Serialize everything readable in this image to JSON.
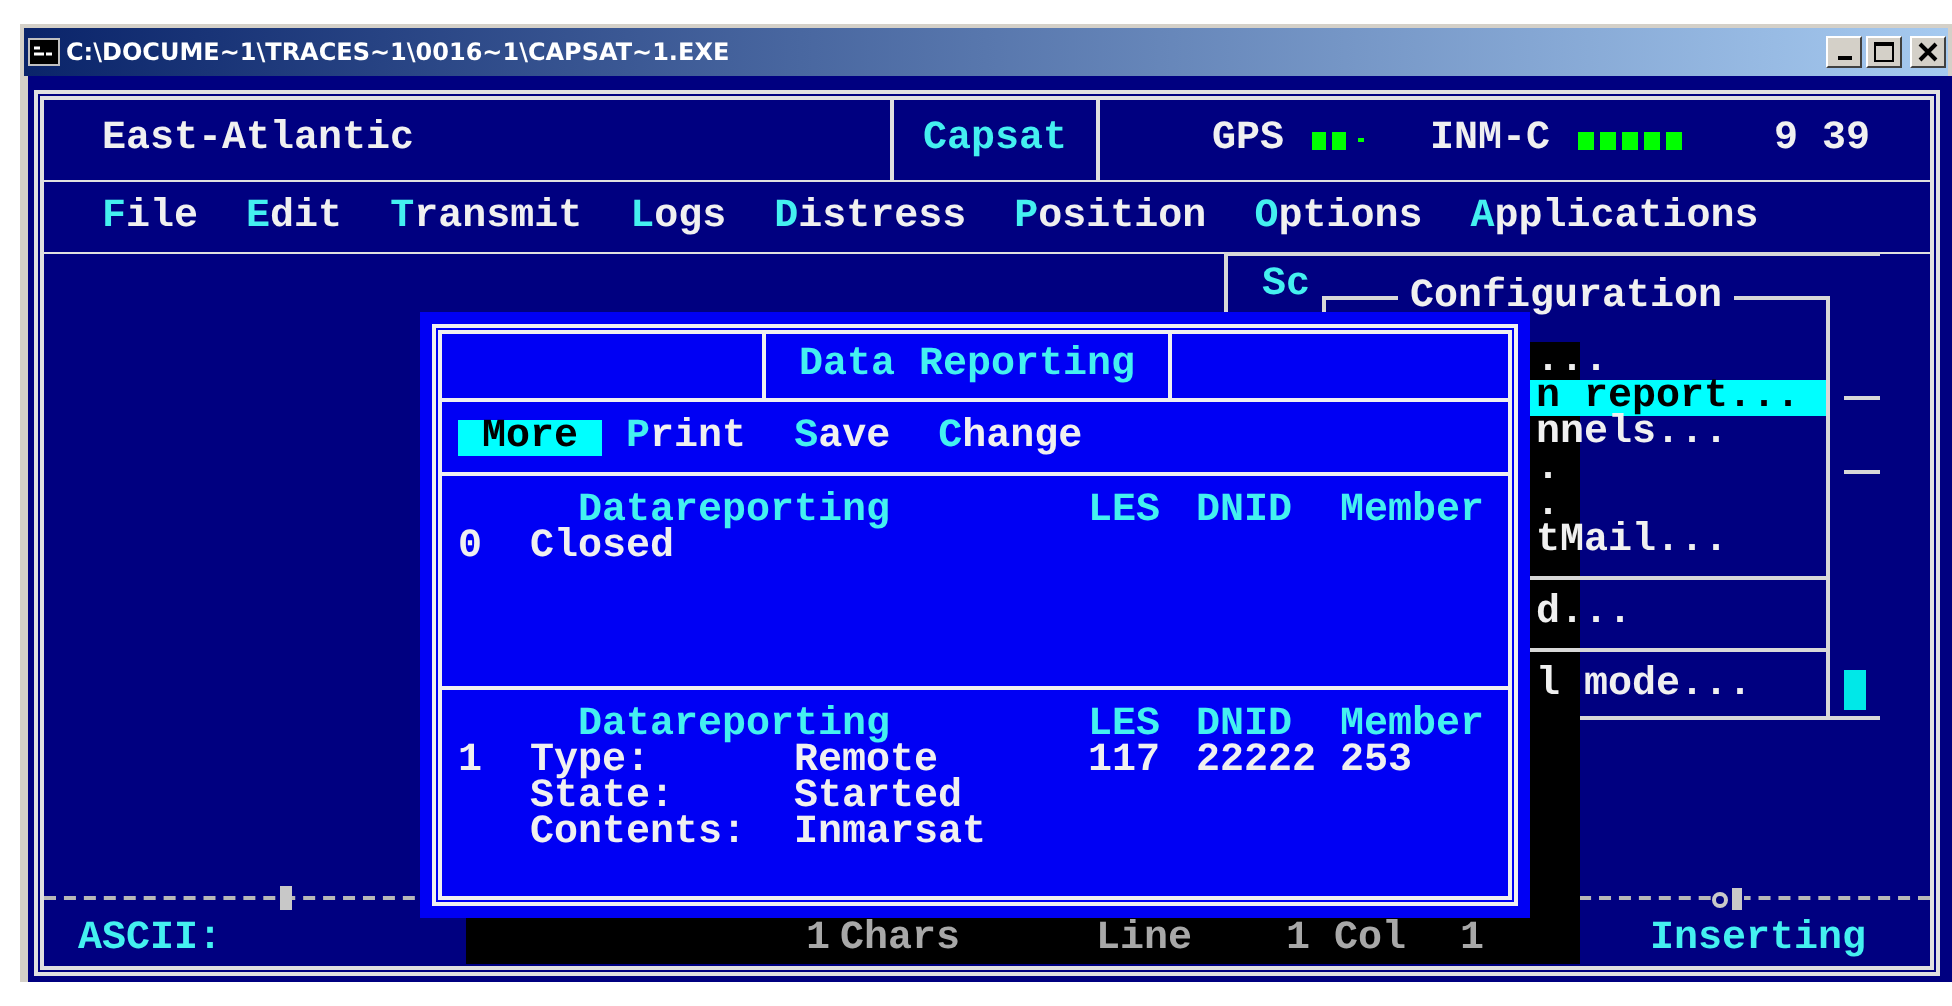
{
  "window": {
    "title": "C:\\DOCUME~1\\TRACES~1\\0016~1\\CAPSAT~1.EXE"
  },
  "header": {
    "region": "East-Atlantic",
    "app": "Capsat",
    "gps_label": "GPS",
    "inm_label": "INM-C",
    "time": "9 39"
  },
  "menu": [
    {
      "label": "File"
    },
    {
      "label": "Edit"
    },
    {
      "label": "Transmit"
    },
    {
      "label": "Logs"
    },
    {
      "label": "Distress"
    },
    {
      "label": "Position"
    },
    {
      "label": "Options"
    },
    {
      "label": "Applications"
    }
  ],
  "config_menu": {
    "prefix": "Sc",
    "title": "Configuration",
    "items": [
      {
        "label": "...",
        "selected": false,
        "separator_after": false
      },
      {
        "label": "n report...",
        "selected": true,
        "separator_after": false
      },
      {
        "label": "nnels...",
        "selected": false,
        "separator_after": false
      },
      {
        "label": ".",
        "selected": false,
        "separator_after": false
      },
      {
        "label": ".",
        "selected": false,
        "separator_after": false
      },
      {
        "label": "tMail...",
        "selected": false,
        "separator_after": true
      },
      {
        "label": "d...",
        "selected": false,
        "separator_after": true
      },
      {
        "label": "l mode...",
        "selected": false,
        "separator_after": false
      }
    ]
  },
  "dialog": {
    "title": "Data Reporting",
    "actions": [
      {
        "label": "More",
        "selected": true
      },
      {
        "label": "Print",
        "selected": false
      },
      {
        "label": "Save",
        "selected": false
      },
      {
        "label": "Change",
        "selected": false
      }
    ],
    "sections": [
      {
        "columns": [
          "Datareporting",
          "LES",
          "DNID",
          "Member"
        ],
        "index": "0",
        "lines": [
          {
            "label": "Closed"
          }
        ]
      },
      {
        "columns": [
          "Datareporting",
          "LES",
          "DNID",
          "Member"
        ],
        "index": "1",
        "les": "117",
        "dnid": "22222",
        "member": "253",
        "lines": [
          {
            "label": "Type:",
            "value": "Remote"
          },
          {
            "label": "State:",
            "value": "Started"
          },
          {
            "label": "Contents:",
            "value": "Inmarsat"
          }
        ]
      }
    ]
  },
  "status_bar": {
    "mode_label": "ASCII:",
    "chars_count": "1",
    "chars_label": "Chars",
    "line_label": "Line",
    "line": "1",
    "col_label": "Col",
    "col": "1",
    "insert_mode": "Inserting"
  }
}
